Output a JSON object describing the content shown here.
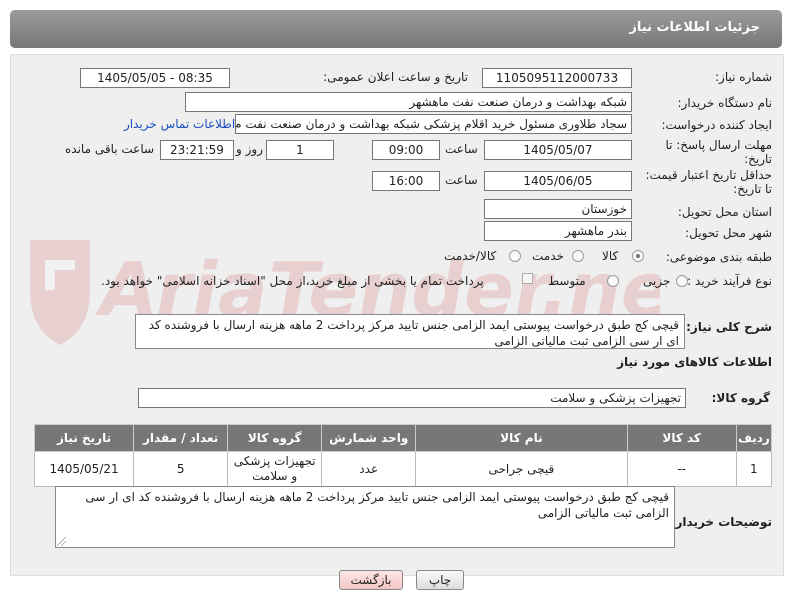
{
  "header": {
    "title": "جزئیات اطلاعات نیاز"
  },
  "form": {
    "need_number": {
      "label": "شماره نیاز:",
      "value": "1105095112000733"
    },
    "announce": {
      "label": "تاریخ و ساعت اعلان عمومی:",
      "value": "1405/05/05 - 08:35"
    },
    "buyer_org": {
      "label": "نام دستگاه خریدار:",
      "value": "شبکه بهداشت و درمان صنعت نفت ماهشهر"
    },
    "creator": {
      "label": "ایجاد کننده درخواست:",
      "value": "سجاد طلاوری مسئول خرید اقلام پزشکی شبکه بهداشت و درمان صنعت نفت م",
      "contact_link": "اطلاعات تماس خریدار"
    },
    "reply_deadline": {
      "label_line1": "مهلت ارسال پاسخ: تا",
      "label_line2": "تاریخ:",
      "date": "1405/05/07",
      "time_label": "ساعت",
      "time": "09:00",
      "days": "1",
      "days_label": "روز و",
      "remaining": "23:21:59",
      "remaining_label": "ساعت باقی مانده"
    },
    "price_validity": {
      "label_line1": "حداقل تاریخ اعتبار قیمت:",
      "label_line2": "تا تاریخ:",
      "date": "1405/06/05",
      "time_label": "ساعت",
      "time": "16:00"
    },
    "province": {
      "label": "استان محل تحویل:",
      "value": "خوزستان"
    },
    "city": {
      "label": "شهر محل تحویل:",
      "value": "بندر ماهشهر"
    },
    "category": {
      "label": "طبقه بندی موضوعی:",
      "options": [
        "کالا",
        "خدمت",
        "کالا/خدمت"
      ],
      "selected": "کالا"
    },
    "process": {
      "label": "نوع فرآیند خرید :",
      "options": [
        "جزیی",
        "متوسط"
      ],
      "selected": "جزیی",
      "payment_note": "پرداخت تمام یا بخشی از مبلغ خرید،از محل \"اسناد خزانه اسلامی\" خواهد بود."
    },
    "description": {
      "label": "شرح کلی نیاز:",
      "value": "قیچی کج طبق درخواست پیوستی ایمد الزامی جنس تایید مرکز پرداخت 2 ماهه هزینه ارسال با فروشنده کد ای ار سی الزامی ثبت مالیاتی الزامی"
    },
    "goods_info_title": "اطلاعات کالاهای مورد نیاز",
    "goods_group": {
      "label": "گروه کالا:",
      "value": "تجهیزات پزشکی و سلامت"
    }
  },
  "table": {
    "headers": [
      "ردیف",
      "کد کالا",
      "نام کالا",
      "واحد شمارش",
      "گروه کالا",
      "تعداد / مقدار",
      "تاریخ نیاز"
    ],
    "rows": [
      {
        "row": "1",
        "code": "--",
        "name": "قیچی جراحی",
        "unit": "عدد",
        "group": "تجهیزات پزشکی و سلامت",
        "qty": "5",
        "date": "1405/05/21"
      }
    ]
  },
  "buyer_notes": {
    "label": "توضیحات خریدار:",
    "value": "قیچی کج طبق درخواست پیوستی ایمد الزامی جنس تایید مرکز پرداخت 2 ماهه هزینه ارسال با فروشنده کد ای ار سی الزامی ثبت مالیاتی الزامی"
  },
  "buttons": {
    "print": "چاپ",
    "back": "بازگشت"
  },
  "watermark": {
    "text": "AriaTender.net"
  },
  "colors": {
    "header": "#888888",
    "link": "#1a4fc0",
    "back_button": "#f4c4c4"
  }
}
